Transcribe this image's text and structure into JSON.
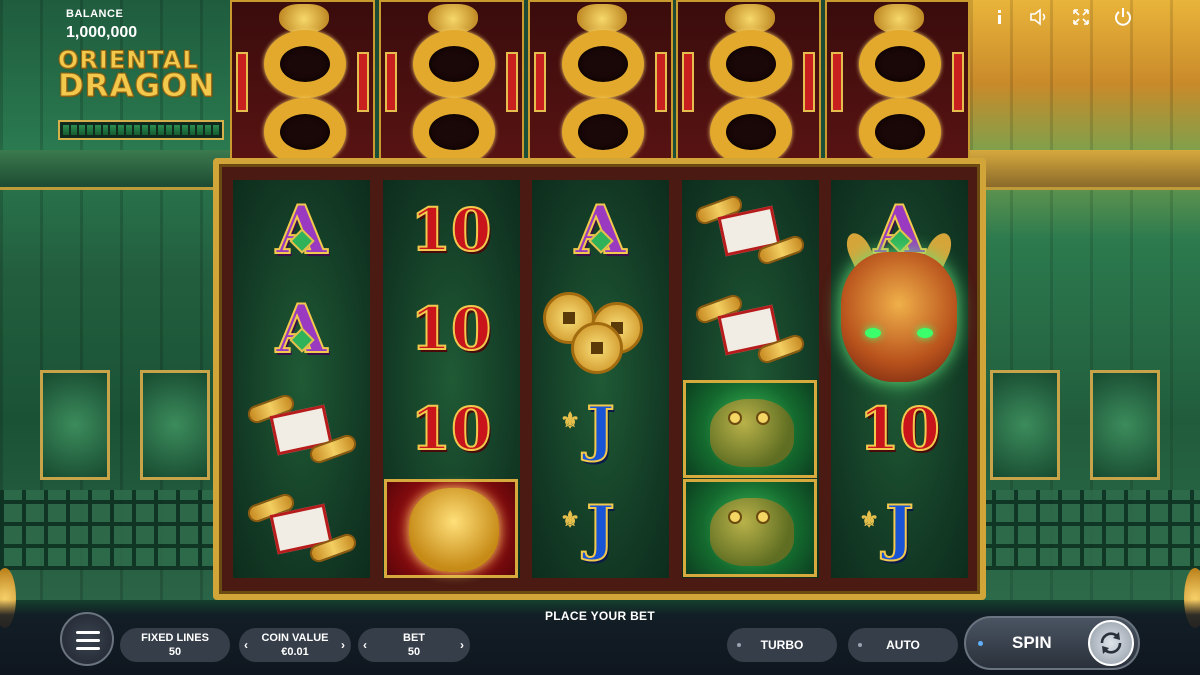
{
  "hud": {
    "balance_label": "BALANCE",
    "balance_value": "1,000,000",
    "logo_line1": "ORIENTAL",
    "logo_line2": "DRAGON"
  },
  "top_icons": [
    "info-icon",
    "sound-icon",
    "fullscreen-icon",
    "power-icon"
  ],
  "reels": [
    [
      "A",
      "A",
      "scroll",
      "scroll"
    ],
    [
      "10",
      "10",
      "10",
      "lion"
    ],
    [
      "A",
      "coins",
      "J",
      "J"
    ],
    [
      "scroll",
      "scroll",
      "toad",
      "toad"
    ],
    [
      "A",
      "dragon",
      "10",
      "J"
    ]
  ],
  "symbol_text": {
    "A": "A",
    "10": "10",
    "J": "J",
    "fleur": "⚜"
  },
  "bottom": {
    "place_bet": "PLACE YOUR BET",
    "fixed_lines_label": "FIXED LINES",
    "fixed_lines_value": "50",
    "coin_value_label": "COIN VALUE",
    "coin_value_value": "€0.01",
    "bet_label": "BET",
    "bet_value": "50",
    "turbo_label": "TURBO",
    "auto_label": "AUTO",
    "spin_label": "SPIN",
    "arrow_left": "‹",
    "arrow_right": "›"
  },
  "colors": {
    "gold": "#d2a538",
    "reel_bg": "#123824",
    "a_purple": "#9a3ac0",
    "ten_red": "#c8141a",
    "j_blue": "#1a54d6"
  }
}
